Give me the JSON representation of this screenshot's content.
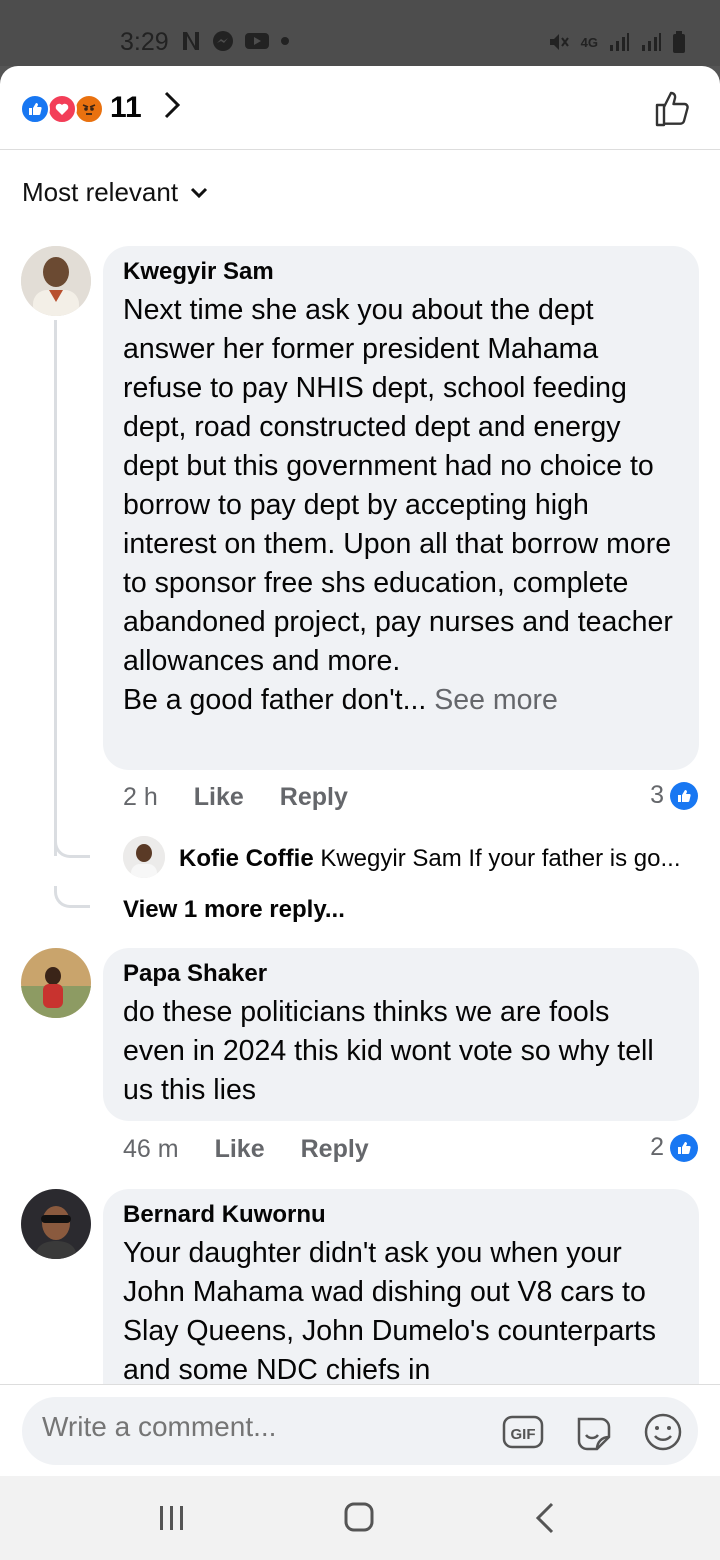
{
  "status_bar": {
    "time": "3:29",
    "left_icons": [
      "netflix-icon",
      "messenger-icon",
      "youtube-icon",
      "dot-icon"
    ],
    "right_icons": [
      "mute-icon",
      "4g-icon",
      "signal-icon",
      "signal-icon",
      "battery-icon"
    ],
    "network": "4G"
  },
  "reactions": {
    "types": [
      "like-icon",
      "love-icon",
      "angry-icon"
    ],
    "count": "11"
  },
  "sort": {
    "label": "Most relevant"
  },
  "comments": [
    {
      "author": "Kwegyir Sam",
      "text": "Next time she ask you about the dept answer her former president Mahama refuse to pay NHIS dept, school feeding dept, road constructed dept and energy dept but this government had no choice to borrow to pay dept by accepting high interest on them. Upon all that borrow more to sponsor free shs education, complete abandoned project, pay nurses and teacher allowances and more.",
      "text_tail": "Be a good father don't...",
      "see_more": "See more",
      "time": "2 h",
      "like_label": "Like",
      "reply_label": "Reply",
      "reaction_count": "3",
      "reply_preview": {
        "author": "Kofie Coffie",
        "text": "Kwegyir Sam If your father is go..."
      },
      "view_more": "View 1 more reply..."
    },
    {
      "author": "Papa Shaker",
      "text": "do these politicians thinks we are fools even in 2024 this kid wont vote so why tell us this lies",
      "time": "46 m",
      "like_label": "Like",
      "reply_label": "Reply",
      "reaction_count": "2"
    },
    {
      "author": "Bernard Kuwornu",
      "text": "Your daughter didn't ask you when your John Mahama wad dishing out V8 cars to Slay Queens, John Dumelo's counterparts and some NDC chiefs in"
    }
  ],
  "composer": {
    "placeholder": "Write a comment...",
    "icons": [
      "gif-icon",
      "sticker-icon",
      "emoji-icon"
    ]
  },
  "nav": {
    "buttons": [
      "recents-icon",
      "home-icon",
      "back-icon"
    ]
  },
  "colors": {
    "facebook_blue": "#1877f2",
    "bubble_bg": "#f0f2f5",
    "secondary_text": "#65676b"
  }
}
